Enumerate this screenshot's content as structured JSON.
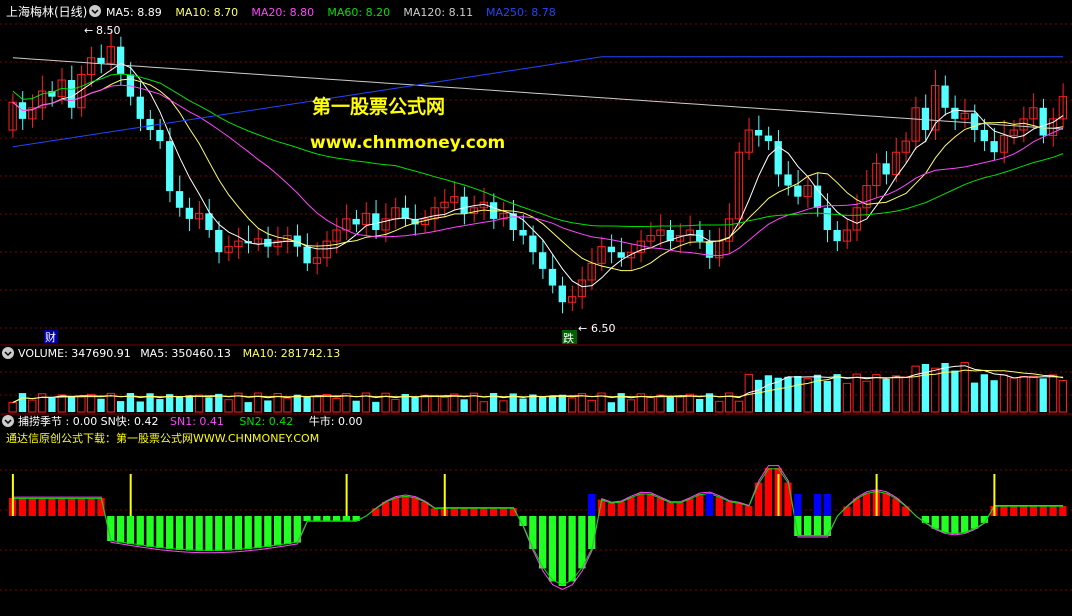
{
  "colors": {
    "background": "#000000",
    "grid": "#7a0000",
    "separator": "#800000",
    "up": "#ff2020",
    "down": "#54ffff",
    "ma5": "#ffffff",
    "ma10": "#ffff66",
    "ma20": "#ff44ff",
    "ma60": "#00e000",
    "ma120": "#cccccc",
    "ma250": "#2244ff",
    "watermark": "#ffff00",
    "hist_pos": "#ff0000",
    "hist_neg": "#22ff22",
    "signal_yellow": "#ffff00",
    "signal_blue": "#0000ff",
    "signal_cyan": "#00ffff"
  },
  "price_panel": {
    "stock_name": "上海梅林(日线)",
    "menu_icon": "circle-chevron-down-icon",
    "legend": [
      {
        "label": "MA5: 8.89",
        "color": "#ffffff"
      },
      {
        "label": "MA10: 8.70",
        "color": "#ffff66"
      },
      {
        "label": "MA20: 8.80",
        "color": "#ff44ff"
      },
      {
        "label": "MA60: 8.20",
        "color": "#00e000"
      },
      {
        "label": "MA120: 8.11",
        "color": "#cccccc"
      },
      {
        "label": "MA250: 8.78",
        "color": "#2244ff"
      }
    ],
    "high_label": "8.50",
    "low_label": "6.50",
    "badge_cai": "财",
    "badge_die": "跌",
    "watermark_title": "第一股票公式网",
    "watermark_url": "www.chnmoney.com"
  },
  "volume_panel": {
    "legend": [
      {
        "label": "VOLUME: 347690.91",
        "color": "#ffffff"
      },
      {
        "label": "MA5: 350460.13",
        "color": "#ffffff"
      },
      {
        "label": "MA10: 281742.13",
        "color": "#ffff66"
      }
    ]
  },
  "indicator_panel": {
    "legend": [
      {
        "label": "捕捞季节 : 0.00",
        "color": "#ffffff"
      },
      {
        "label": "SN快: 0.42",
        "color": "#ffffff"
      },
      {
        "label": "SN1: 0.41",
        "color": "#ff44ff"
      },
      {
        "label": "SN2: 0.42",
        "color": "#00e000"
      },
      {
        "label": "牛市: 0.00",
        "color": "#ffffff"
      }
    ],
    "note": "通达信原创公式下载：第一股票公式网WWW.CHNMONEY.COM"
  },
  "chart_data": {
    "type": "candlestick",
    "price_range": [
      6.3,
      9.0
    ],
    "candle_count": 108,
    "candles_seed": [
      [
        8.1,
        8.35
      ],
      [
        8.35,
        8.2
      ],
      [
        8.2,
        8.3
      ],
      [
        8.3,
        8.45
      ],
      [
        8.45,
        8.4
      ],
      [
        8.4,
        8.55
      ],
      [
        8.55,
        8.3
      ],
      [
        8.3,
        8.6
      ],
      [
        8.6,
        8.75
      ],
      [
        8.75,
        8.7
      ],
      [
        8.7,
        8.85
      ],
      [
        8.85,
        8.6
      ],
      [
        8.6,
        8.4
      ],
      [
        8.4,
        8.2
      ],
      [
        8.2,
        8.1
      ],
      [
        8.1,
        8.0
      ],
      [
        8.0,
        7.55
      ],
      [
        7.55,
        7.4
      ],
      [
        7.4,
        7.3
      ],
      [
        7.3,
        7.35
      ],
      [
        7.35,
        7.2
      ],
      [
        7.2,
        7.0
      ],
      [
        7.0,
        7.05
      ],
      [
        7.05,
        7.1
      ],
      [
        7.1,
        7.08
      ],
      [
        7.08,
        7.12
      ],
      [
        7.12,
        7.05
      ],
      [
        7.05,
        7.1
      ],
      [
        7.1,
        7.15
      ],
      [
        7.15,
        7.05
      ],
      [
        7.05,
        6.9
      ],
      [
        6.9,
        6.95
      ],
      [
        6.95,
        7.1
      ],
      [
        7.1,
        7.2
      ],
      [
        7.2,
        7.3
      ],
      [
        7.3,
        7.25
      ],
      [
        7.25,
        7.35
      ],
      [
        7.35,
        7.2
      ],
      [
        7.2,
        7.3
      ],
      [
        7.3,
        7.4
      ],
      [
        7.4,
        7.3
      ],
      [
        7.3,
        7.25
      ],
      [
        7.25,
        7.3
      ],
      [
        7.3,
        7.4
      ],
      [
        7.4,
        7.45
      ],
      [
        7.45,
        7.5
      ],
      [
        7.5,
        7.35
      ],
      [
        7.35,
        7.4
      ],
      [
        7.4,
        7.45
      ],
      [
        7.45,
        7.3
      ],
      [
        7.3,
        7.35
      ],
      [
        7.35,
        7.2
      ],
      [
        7.2,
        7.15
      ],
      [
        7.15,
        7.0
      ],
      [
        7.0,
        6.85
      ],
      [
        6.85,
        6.7
      ],
      [
        6.7,
        6.55
      ],
      [
        6.55,
        6.6
      ],
      [
        6.6,
        6.75
      ],
      [
        6.75,
        6.9
      ],
      [
        6.9,
        7.05
      ],
      [
        7.05,
        7.0
      ],
      [
        7.0,
        6.95
      ],
      [
        6.95,
        7.0
      ],
      [
        7.0,
        7.1
      ],
      [
        7.1,
        7.15
      ],
      [
        7.15,
        7.2
      ],
      [
        7.2,
        7.1
      ],
      [
        7.1,
        7.15
      ],
      [
        7.15,
        7.2
      ],
      [
        7.2,
        7.1
      ],
      [
        7.1,
        6.95
      ],
      [
        6.95,
        7.1
      ],
      [
        7.1,
        7.3
      ],
      [
        7.3,
        7.9
      ],
      [
        7.9,
        8.1
      ],
      [
        8.1,
        8.05
      ],
      [
        8.05,
        8.0
      ],
      [
        8.0,
        7.7
      ],
      [
        7.7,
        7.6
      ],
      [
        7.6,
        7.5
      ],
      [
        7.5,
        7.6
      ],
      [
        7.6,
        7.4
      ],
      [
        7.4,
        7.2
      ],
      [
        7.2,
        7.1
      ],
      [
        7.1,
        7.2
      ],
      [
        7.2,
        7.4
      ],
      [
        7.4,
        7.6
      ],
      [
        7.6,
        7.8
      ],
      [
        7.8,
        7.7
      ],
      [
        7.7,
        7.9
      ],
      [
        7.9,
        8.0
      ],
      [
        8.0,
        8.3
      ],
      [
        8.3,
        8.1
      ],
      [
        8.1,
        8.5
      ],
      [
        8.5,
        8.3
      ],
      [
        8.3,
        8.2
      ],
      [
        8.2,
        8.25
      ],
      [
        8.25,
        8.1
      ],
      [
        8.1,
        8.0
      ],
      [
        8.0,
        7.9
      ],
      [
        7.9,
        8.05
      ],
      [
        8.05,
        8.1
      ],
      [
        8.1,
        8.2
      ],
      [
        8.2,
        8.3
      ],
      [
        8.3,
        8.05
      ],
      [
        8.05,
        8.2
      ],
      [
        8.2,
        8.4
      ]
    ]
  }
}
